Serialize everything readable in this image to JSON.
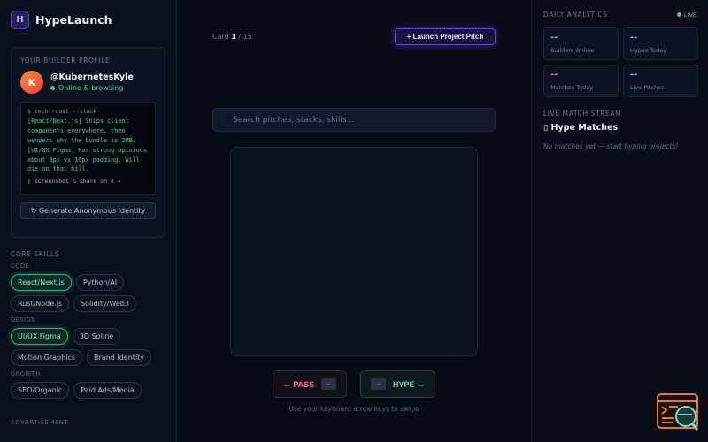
{
  "app": {
    "logo_letter": "H",
    "name": "HypeLaunch"
  },
  "profile": {
    "section_title": "YOUR BUILDER PROFILE",
    "avatar_letter": "K",
    "username": "@KubernetesKyle",
    "status": "Online & browsing",
    "terminal": {
      "command": "$ tech-roast --stack",
      "lines": [
        "[React/Next.js] Ships client",
        "components everywhere, then",
        "wonders why the bundle is 2MB.",
        "[UI/UX Figma] Has strong opinions",
        "about 8px vs 10px padding. Will",
        "die on that hill."
      ],
      "footer": "▯ screenshot & share on X →"
    },
    "generate_button": "↻ Generate Anonymous Identity"
  },
  "skills": {
    "title": "CORE SKILLS",
    "groups": [
      {
        "label": "CODE",
        "chips": [
          "React/Next.js",
          "Python/AI",
          "Rust/Node.js",
          "Solidity/Web3"
        ]
      },
      {
        "label": "DESIGN",
        "chips": [
          "UI/UX Figma",
          "3D Spline",
          "Motion Graphics",
          "Brand Identity"
        ]
      },
      {
        "label": "GROWTH",
        "chips": [
          "SEO/Organic",
          "Paid Ads/Media"
        ]
      }
    ],
    "active": [
      "React/Next.js",
      "UI/UX Figma"
    ],
    "ad_label": "ADVERTISEMENT"
  },
  "main": {
    "card_label": "Card",
    "card_index": "1",
    "card_total": "/ 15",
    "launch_button": "+ Launch Project Pitch",
    "search_placeholder": "Search pitches, stacks, skills...",
    "pass_label": "← PASS",
    "pass_key": "←",
    "hype_label": "HYPE →",
    "hype_key": "→",
    "hint": "Use your keyboard arrow keys to swipe"
  },
  "analytics": {
    "title": "DAILY ANALYTICS",
    "live": "LIVE",
    "stats": [
      {
        "value": "--",
        "label": "Builders Online",
        "color": "#3dd68c"
      },
      {
        "value": "--",
        "label": "Hypes Today",
        "color": "#8aa4ff"
      },
      {
        "value": "--",
        "label": "Matches Today",
        "color": "#ff6b84"
      },
      {
        "value": "--",
        "label": "Live Pitches",
        "color": "#4fc3f7"
      }
    ],
    "stream_title": "LIVE MATCH STREAM",
    "matches_title": "▯ Hype Matches",
    "empty": "No matches yet — start hyping projects!"
  }
}
